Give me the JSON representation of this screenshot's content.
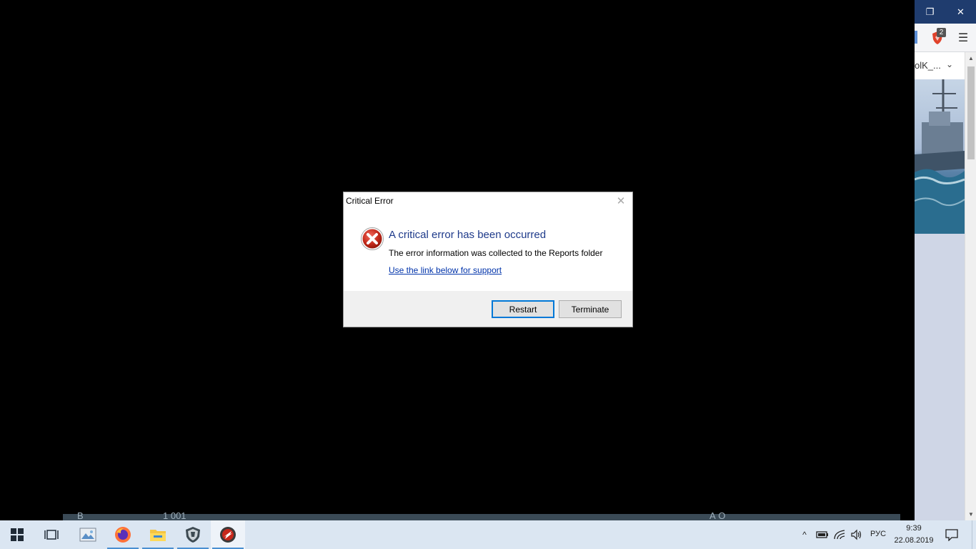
{
  "dialog": {
    "title": "Critical Error",
    "heading": "A critical error has been occurred",
    "message": "The error information was collected to the Reports folder",
    "link": "Use the link below for support",
    "restart_label": "Restart",
    "terminate_label": "Terminate",
    "close_glyph": "✕"
  },
  "browser": {
    "tab_label": "olK_...",
    "extension_badge": "2",
    "restore_glyph": "❐",
    "close_glyph": "✕",
    "menu_glyph": "☰",
    "chevron_glyph": "⌄"
  },
  "game": {
    "bottom_text_left": "В",
    "bottom_text_mid": "1 001",
    "bottom_text_right": "А О"
  },
  "taskbar": {
    "language": "РУС",
    "time": "9:39",
    "date": "22.08.2019",
    "tray_chevron": "^"
  },
  "colors": {
    "taskbar": "#dbe6f2",
    "accent": "#0078d7",
    "error_red": "#c42b1c",
    "heading_blue": "#1e3a8a",
    "browser_titlebar": "#1f3c6e"
  }
}
